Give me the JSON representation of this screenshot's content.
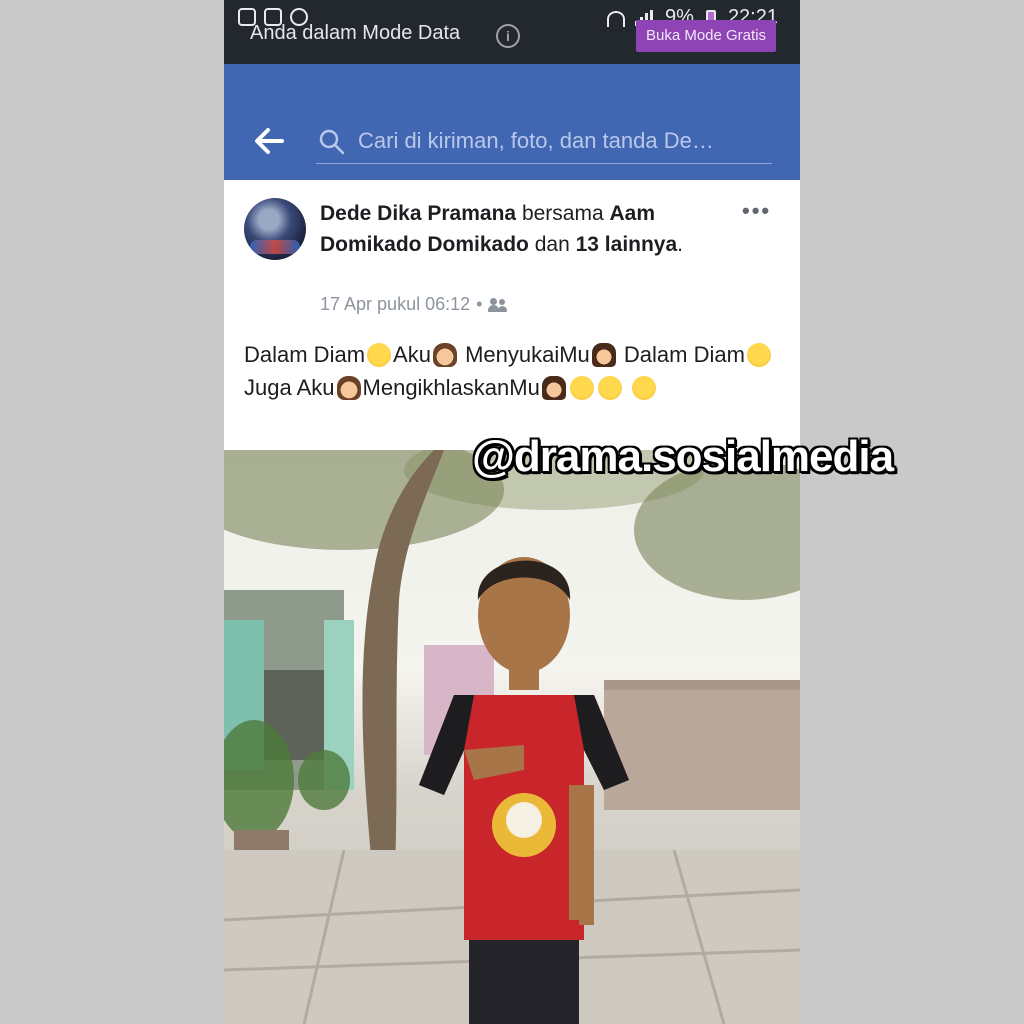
{
  "status_bar": {
    "notice": "Anda dalam Mode Data",
    "battery": "9%",
    "time": "22:21",
    "free_mode_button": "Buka Mode Gratis",
    "accent_color": "#8e44b5"
  },
  "header": {
    "back_icon": "arrow-left-icon",
    "search_placeholder": "Cari di kiriman, foto, dan tanda De…",
    "background_color": "#4267b2"
  },
  "post": {
    "author": "Dede Dika Pramana",
    "with_word": "bersama",
    "tagged": "Aam Domikado Domikado",
    "and_word": "dan",
    "others": "13 lainnya",
    "timestamp": "17 Apr pukul 06:12",
    "privacy_icon": "friends-icon",
    "text_parts": [
      "Dalam Diam",
      "Aku",
      "MenyukaiMu",
      "Dalam Diam",
      "Juga Aku",
      "MengikhlaskanMu"
    ]
  },
  "watermark": "@drama.sosialmedia"
}
